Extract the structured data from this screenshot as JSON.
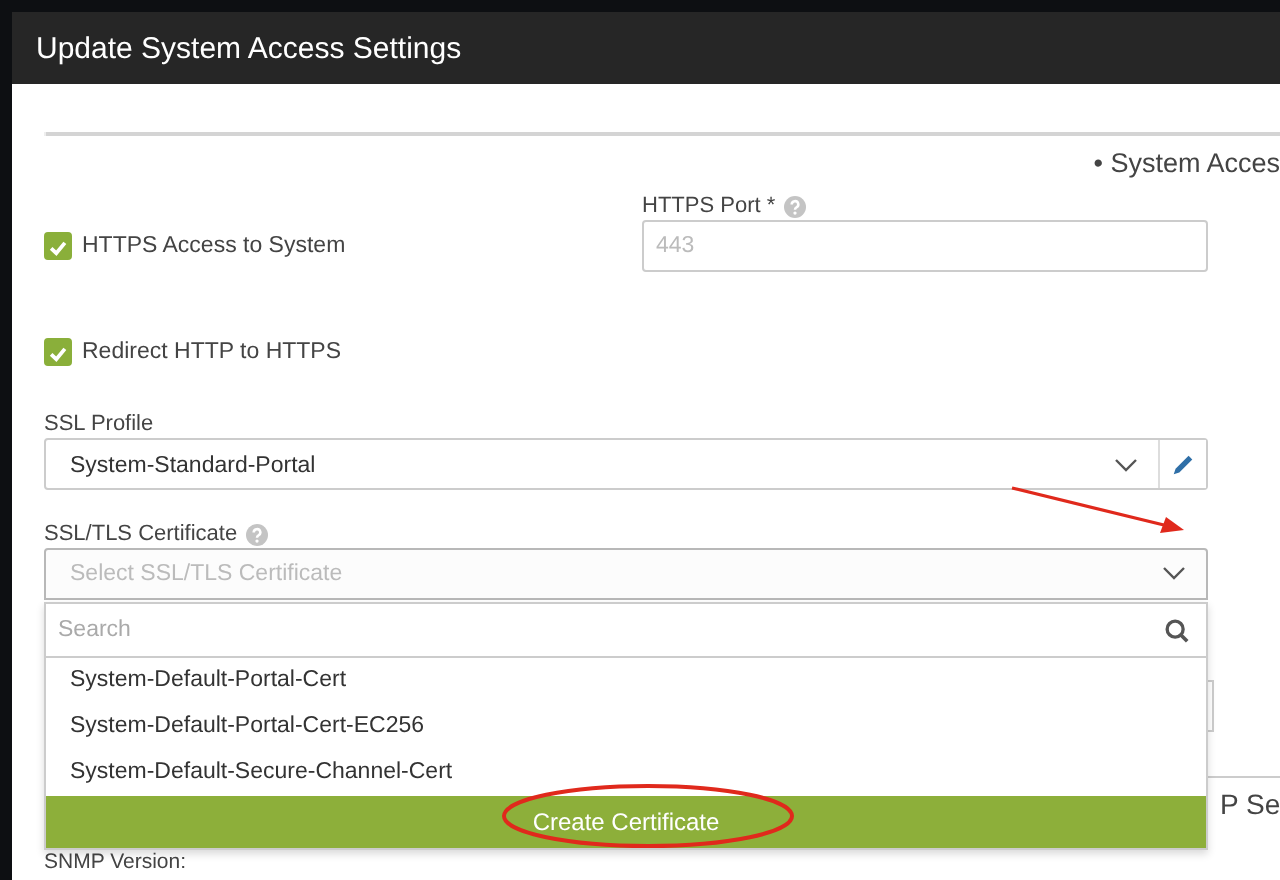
{
  "window": {
    "title": "Update System Access Settings"
  },
  "section_heading": "• System Acces",
  "https_access": {
    "label": "HTTPS Access to System",
    "checked": true
  },
  "https_port": {
    "label": "HTTPS Port *",
    "value": "443",
    "disabled": true
  },
  "redirect": {
    "label": "Redirect HTTP to HTTPS",
    "checked": true
  },
  "ssl_profile": {
    "label": "SSL Profile",
    "value": "System-Standard-Portal"
  },
  "certificate": {
    "label": "SSL/TLS Certificate",
    "placeholder": "Select SSL/TLS Certificate",
    "expanded": true,
    "search": {
      "placeholder": "Search"
    },
    "options": [
      {
        "label": "System-Default-Portal-Cert"
      },
      {
        "label": "System-Default-Portal-Cert-EC256"
      },
      {
        "label": "System-Default-Secure-Channel-Cert"
      }
    ],
    "action": "Create Certificate"
  },
  "next_section_heading": "P Se",
  "snmp_label": "SNMP Version:"
}
